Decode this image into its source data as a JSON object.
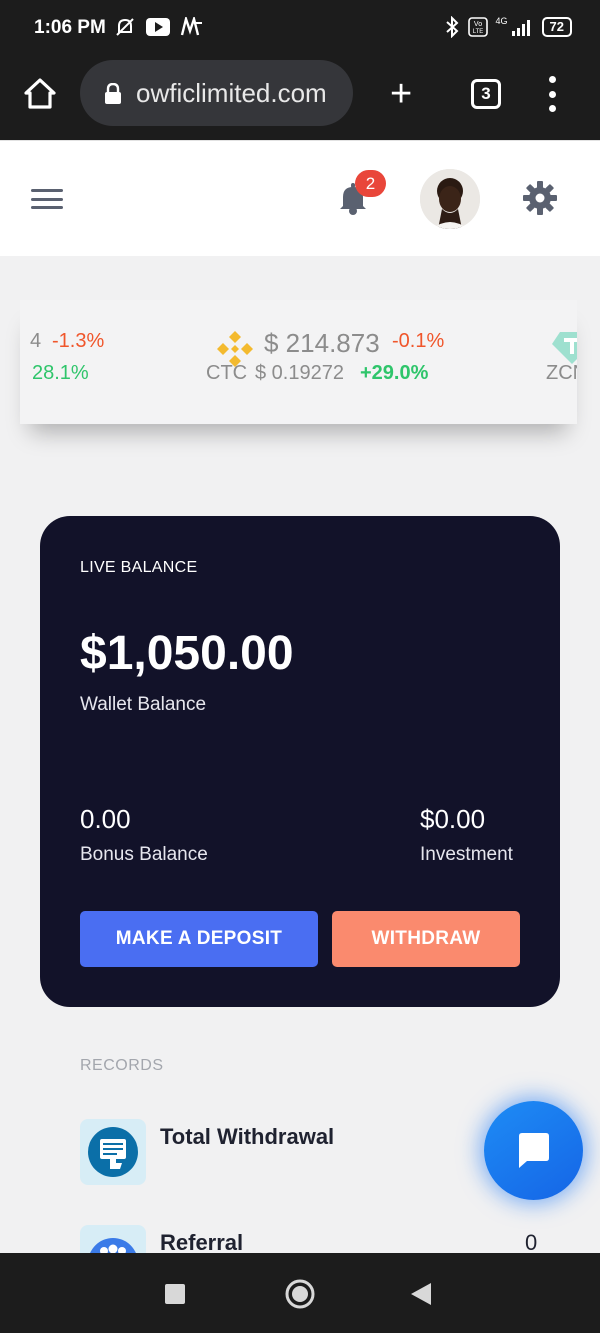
{
  "status_bar": {
    "time": "1:06 PM",
    "battery": "72",
    "network": "4G",
    "icons_left": [
      "notifications-off-icon",
      "youtube-icon",
      "app-icon"
    ],
    "icons_right": [
      "bluetooth-icon",
      "volte-icon",
      "signal-icon",
      "battery-icon"
    ]
  },
  "browser": {
    "url": "owficlimited.com",
    "tab_count": "3"
  },
  "header": {
    "notification_count": "2"
  },
  "ticker": {
    "items": [
      {
        "price_fragment": "4",
        "change": "-1.3%"
      },
      {
        "change_fragment": "28.1%"
      },
      {
        "price": "$ 214.873",
        "change": "-0.1%"
      },
      {
        "symbol": "CTC",
        "price": "$ 0.19272",
        "change": "+29.0%"
      },
      {
        "symbol_fragment": "ZCN"
      }
    ]
  },
  "balance_card": {
    "label": "LIVE BALANCE",
    "amount": "$1,050.00",
    "amount_caption": "Wallet Balance",
    "bonus_value": "0.00",
    "bonus_caption": "Bonus Balance",
    "investment_value": "$0.00",
    "investment_caption": "Investment",
    "deposit_label": "MAKE A DEPOSIT",
    "withdraw_label": "WITHDRAW"
  },
  "records": {
    "label": "RECORDS",
    "items": [
      {
        "title": "Total Withdrawal",
        "value": ""
      },
      {
        "title": "Referral",
        "value": "0"
      }
    ]
  },
  "colors": {
    "card_bg": "#121229",
    "deposit_btn": "#4a6ef2",
    "withdraw_btn": "#fa8a6e",
    "negative": "#f0562b",
    "positive": "#2fc56b",
    "chat_fab": "#1e7ef2"
  }
}
